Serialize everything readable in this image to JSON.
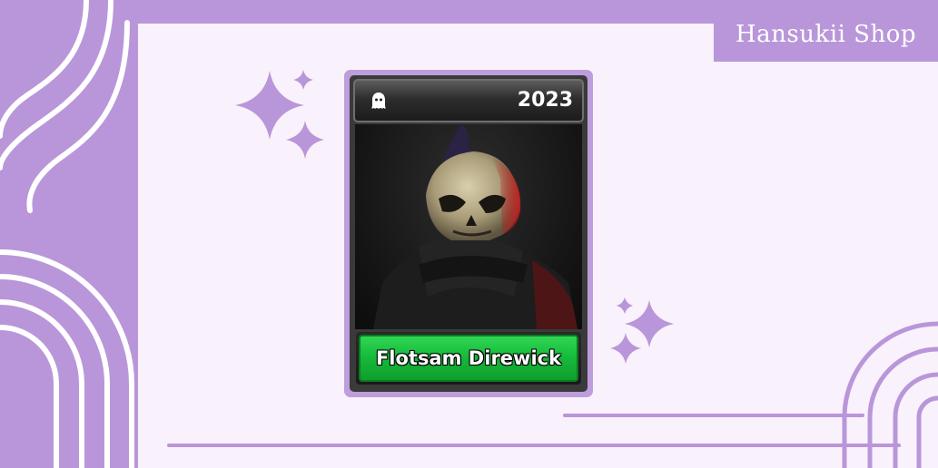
{
  "shop": {
    "name": "Hansukii Shop"
  },
  "card": {
    "year": "2023",
    "item_name": "Flotsam Direwick",
    "top_icon": "ghost-icon",
    "name_plate_color": "#1bbf3e",
    "frame_color": "#bd9ddc"
  },
  "theme": {
    "accent": "#b996d9",
    "panel_background": "#f9f1fb",
    "sparkle_color": "#b996d9"
  },
  "decor_icons": [
    "sparkle-icon",
    "sparkle-icon",
    "sparkle-icon",
    "sparkle-icon",
    "sparkle-icon",
    "sparkle-icon"
  ]
}
